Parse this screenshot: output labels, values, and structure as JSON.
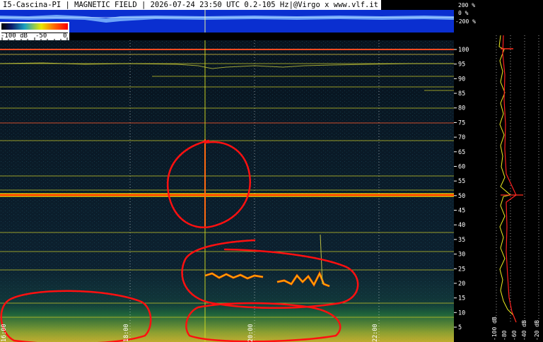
{
  "header": {
    "title": "I5-Cascina-PI | MAGNETIC FIELD | 2026-07-24 23:50 UTC 0.2-105 Hz|@Virgo x www.vlf.it"
  },
  "amplitude_strip": {
    "labels": [
      "200 %",
      "0 %",
      "-200 %"
    ]
  },
  "color_legend": {
    "min_label": "-100 dB",
    "mid_label": "-50",
    "max_label": "0"
  },
  "frequency_axis": {
    "unit": "Hz",
    "ticks": [
      100,
      95,
      90,
      85,
      80,
      75,
      70,
      65,
      60,
      55,
      50,
      45,
      40,
      35,
      30,
      25,
      20,
      15,
      10,
      5
    ]
  },
  "time_axis": {
    "ticks": [
      "16:00",
      "18:00",
      "20:00",
      "22:00"
    ]
  },
  "spectrum_axis": {
    "ticks": [
      "-100 dB",
      "-80",
      "-60",
      "-40 dB",
      "-20 dB"
    ]
  },
  "colors": {
    "title_bg": "#ffffff",
    "amp_strip": "#0a2fd0",
    "annotation": "#ff1010",
    "spectral_line": "#e8e800",
    "hot_line": "#ff3300"
  }
}
